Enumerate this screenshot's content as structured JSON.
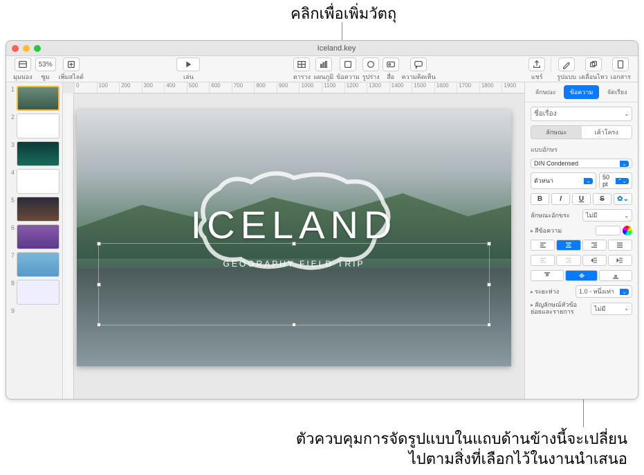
{
  "callouts": {
    "top": "คลิกเพื่อเพิ่มวัตถุ",
    "bottom_line1": "ตัวควบคุมการจัดรูปแบบในแถบด้านข้างนี้จะเปลี่ยน",
    "bottom_line2": "ไปตามสิ่งที่เลือกไว้ในงานนำเสนอ"
  },
  "titlebar": {
    "doc": "Iceland.key"
  },
  "toolbar": {
    "view": "มุมมอง",
    "zoom_val": "53%",
    "zoom": "ซูม",
    "add_slide": "เพิ่มสไลด์",
    "play": "เล่น",
    "table": "ตาราง",
    "chart": "แผนภูมิ",
    "text": "ข้อความ",
    "shape": "รูปร่าง",
    "media": "สื่อ",
    "comment": "ความคิดเห็น",
    "share": "แชร์",
    "format": "รูปแบบ",
    "animate": "เคลื่อนไหว",
    "document": "เอกสาร"
  },
  "ruler": {
    "ticks": [
      "0",
      "100",
      "200",
      "300",
      "400",
      "500",
      "600",
      "700",
      "800",
      "900",
      "1000",
      "1100",
      "1200",
      "1300",
      "1400",
      "1500",
      "1600",
      "1700",
      "1800",
      "1900"
    ]
  },
  "nav": {
    "items": [
      {
        "n": "1"
      },
      {
        "n": "2"
      },
      {
        "n": "3"
      },
      {
        "n": "4"
      },
      {
        "n": "5"
      },
      {
        "n": "6"
      },
      {
        "n": "7"
      },
      {
        "n": "8"
      },
      {
        "n": "9"
      }
    ]
  },
  "slide": {
    "title": "ICELAND",
    "subtitle": "GEOGRAPHY FIELD TRIP"
  },
  "inspector": {
    "tabs": {
      "style": "ลักษณะ",
      "text": "ข้อความ",
      "arrange": "จัดเรียง"
    },
    "para_style": "ชื่อเรื่อง",
    "seg_style": "ลักษณะ",
    "seg_layout": "เค้าโครง",
    "font_label": "แบบอักษร",
    "font_name": "DIN Condensed",
    "typeface": "ตัวหนา",
    "size": "50 pt",
    "b": "B",
    "i": "I",
    "u": "U",
    "s": "S",
    "char_style_label": "ลักษณะอักขระ",
    "char_style_val": "ไม่มี",
    "text_color_label": "สีข้อความ",
    "spacing_label": "ระยะห่าง",
    "spacing_val": "1.0 - หนึ่งเท่า",
    "bullets_label": "สัญลักษณ์หัวข้อย่อยและรายการ",
    "bullets_val": "ไม่มี"
  }
}
